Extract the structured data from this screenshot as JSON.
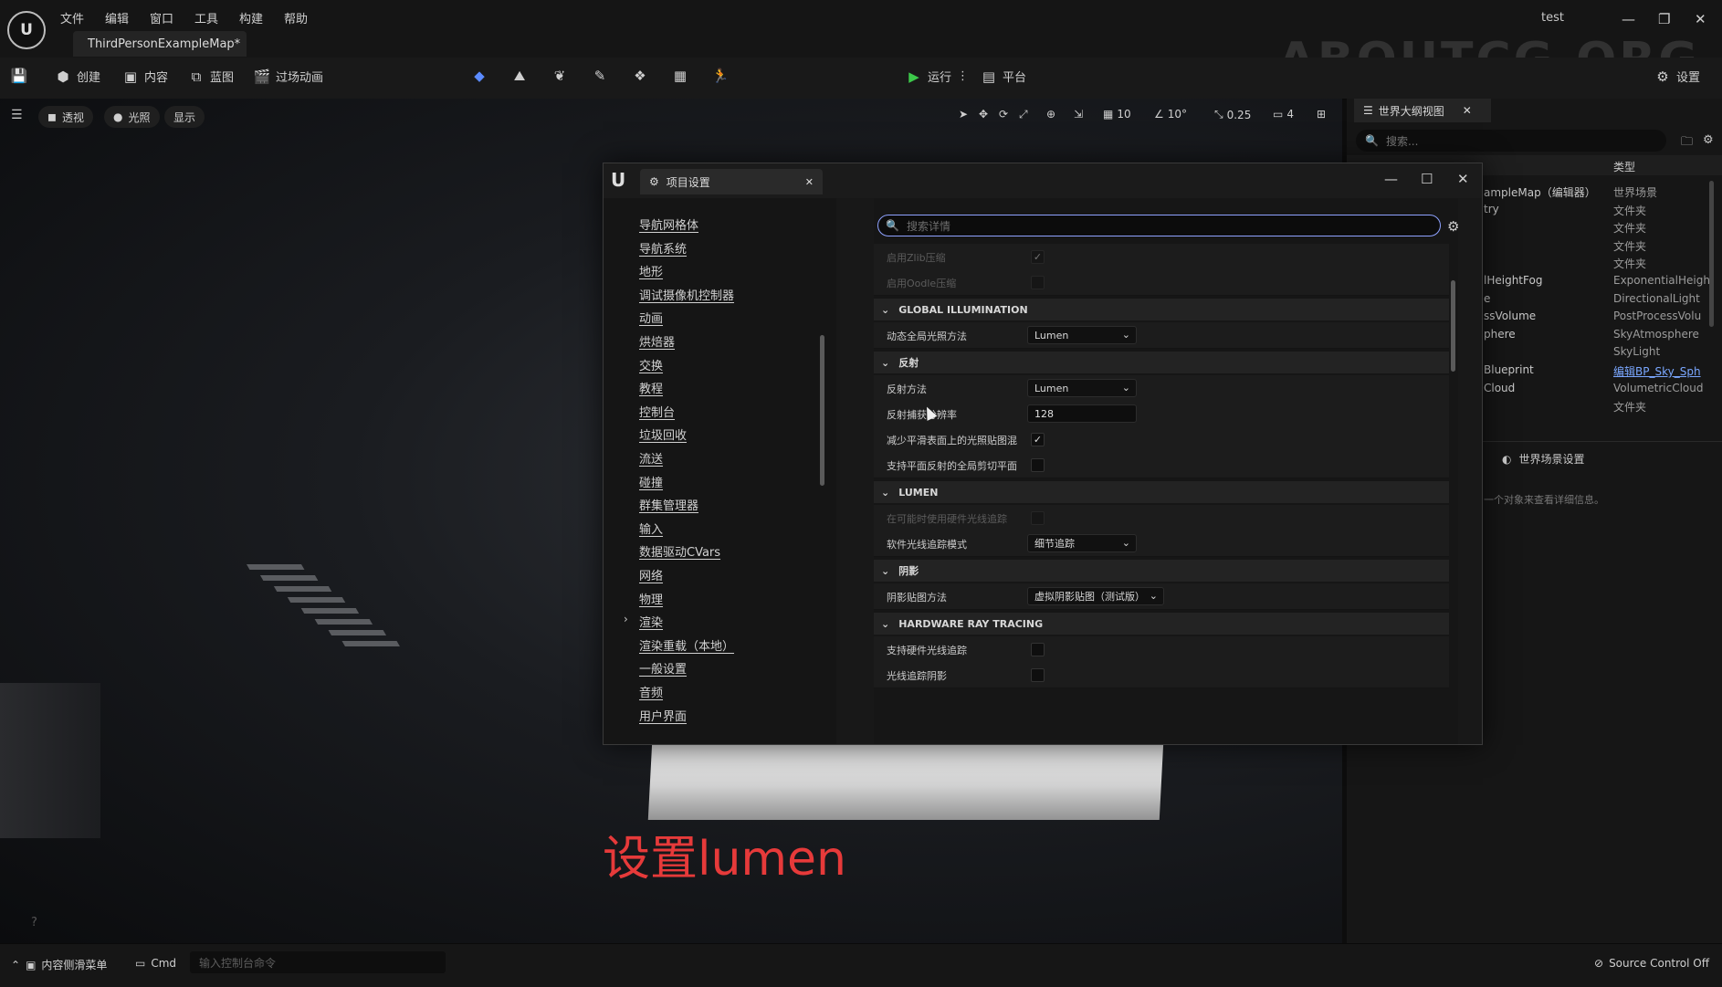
{
  "app": {
    "logo": "U",
    "menu": [
      "文件",
      "编辑",
      "窗口",
      "工具",
      "构建",
      "帮助"
    ],
    "doc_tab": "ThirdPersonExampleMap*",
    "project_name": "test",
    "watermark": "ABOUTCG.ORG"
  },
  "toolbar": {
    "create_label": "创建",
    "content_label": "内容",
    "blueprint_label": "蓝图",
    "cinematics_label": "过场动画",
    "play_label": "运行",
    "platform_label": "平台",
    "settings_label": "设置"
  },
  "viewport": {
    "perspective_label": "透视",
    "lit_label": "光照",
    "show_label": "显示",
    "grid_snap": "10",
    "rotation_snap": "10°",
    "scale_snap": "0.25",
    "camera_speed": "4",
    "caption": "设置lumen"
  },
  "outliner": {
    "tab_label": "世界大纲视图",
    "search_placeholder": "搜索...",
    "type_header": "类型",
    "rows": [
      {
        "name": "ampleMap（编辑器）",
        "type": "世界场景"
      },
      {
        "name": "try",
        "type": "文件夹"
      },
      {
        "name": "",
        "type": "文件夹"
      },
      {
        "name": "",
        "type": "文件夹"
      },
      {
        "name": "",
        "type": "文件夹"
      },
      {
        "name": "lHeightFog",
        "type": "ExponentialHeigh"
      },
      {
        "name": "e",
        "type": "DirectionalLight"
      },
      {
        "name": "ssVolume",
        "type": "PostProcessVolu"
      },
      {
        "name": "phere",
        "type": "SkyAtmosphere"
      },
      {
        "name": "",
        "type": "SkyLight"
      },
      {
        "name": "Blueprint",
        "type": "编辑BP_Sky_Sph"
      },
      {
        "name": "Cloud",
        "type": "VolumetricCloud"
      },
      {
        "name": "",
        "type": "文件夹"
      }
    ],
    "world_settings_label": "世界场景设置",
    "details_hint": "一个对象来查看详细信息。"
  },
  "dialog": {
    "tab_label": "项目设置",
    "categories": [
      "导航网格体",
      "导航系统",
      "地形",
      "调试摄像机控制器",
      "动画",
      "烘焙器",
      "交换",
      "教程",
      "控制台",
      "垃圾回收",
      "流送",
      "碰撞",
      "群集管理器",
      "输入",
      "数据驱动CVars",
      "网络",
      "物理",
      "渲染",
      "渲染重载（本地）",
      "一般设置",
      "音频",
      "用户界面"
    ],
    "expanded_category": "渲染",
    "search_placeholder": "搜索详情",
    "faded_rows": [
      {
        "label": "启用Zlib压缩",
        "checked": true
      },
      {
        "label": "启用Oodle压缩",
        "checked": false
      }
    ],
    "sections": [
      {
        "title": "GLOBAL ILLUMINATION",
        "props": [
          {
            "label": "动态全局光照方法",
            "kind": "dropdown",
            "value": "Lumen"
          }
        ]
      },
      {
        "title": "反射",
        "props": [
          {
            "label": "反射方法",
            "kind": "dropdown",
            "value": "Lumen"
          },
          {
            "label": "反射捕获分辨率",
            "kind": "number",
            "value": "128"
          },
          {
            "label": "减少平滑表面上的光照贴图混",
            "kind": "check",
            "checked": true
          },
          {
            "label": "支持平面反射的全局剪切平面",
            "kind": "check",
            "checked": false
          }
        ]
      },
      {
        "title": "LUMEN",
        "props": [
          {
            "label": "在可能时使用硬件光线追踪",
            "kind": "check",
            "checked": false,
            "disabled": true
          },
          {
            "label": "软件光线追踪模式",
            "kind": "dropdown",
            "value": "细节追踪"
          }
        ]
      },
      {
        "title": "阴影",
        "props": [
          {
            "label": "阴影贴图方法",
            "kind": "dropdown",
            "value": "虚拟阴影贴图（测试版）"
          }
        ]
      },
      {
        "title": "HARDWARE RAY TRACING",
        "props": [
          {
            "label": "支持硬件光线追踪",
            "kind": "check",
            "checked": false
          },
          {
            "label": "光线追踪阴影",
            "kind": "check",
            "checked": false
          }
        ]
      }
    ]
  },
  "statusbar": {
    "drawer_label": "内容侧滑菜单",
    "cmd_label": "Cmd",
    "cmd_placeholder": "输入控制台命令",
    "source_control": "Source Control Off"
  },
  "colors": {
    "caption": "#e63a3a",
    "search_focus": "#8fa2ff",
    "play_green": "#3cc94a",
    "link_blue": "#7aa7ff"
  }
}
